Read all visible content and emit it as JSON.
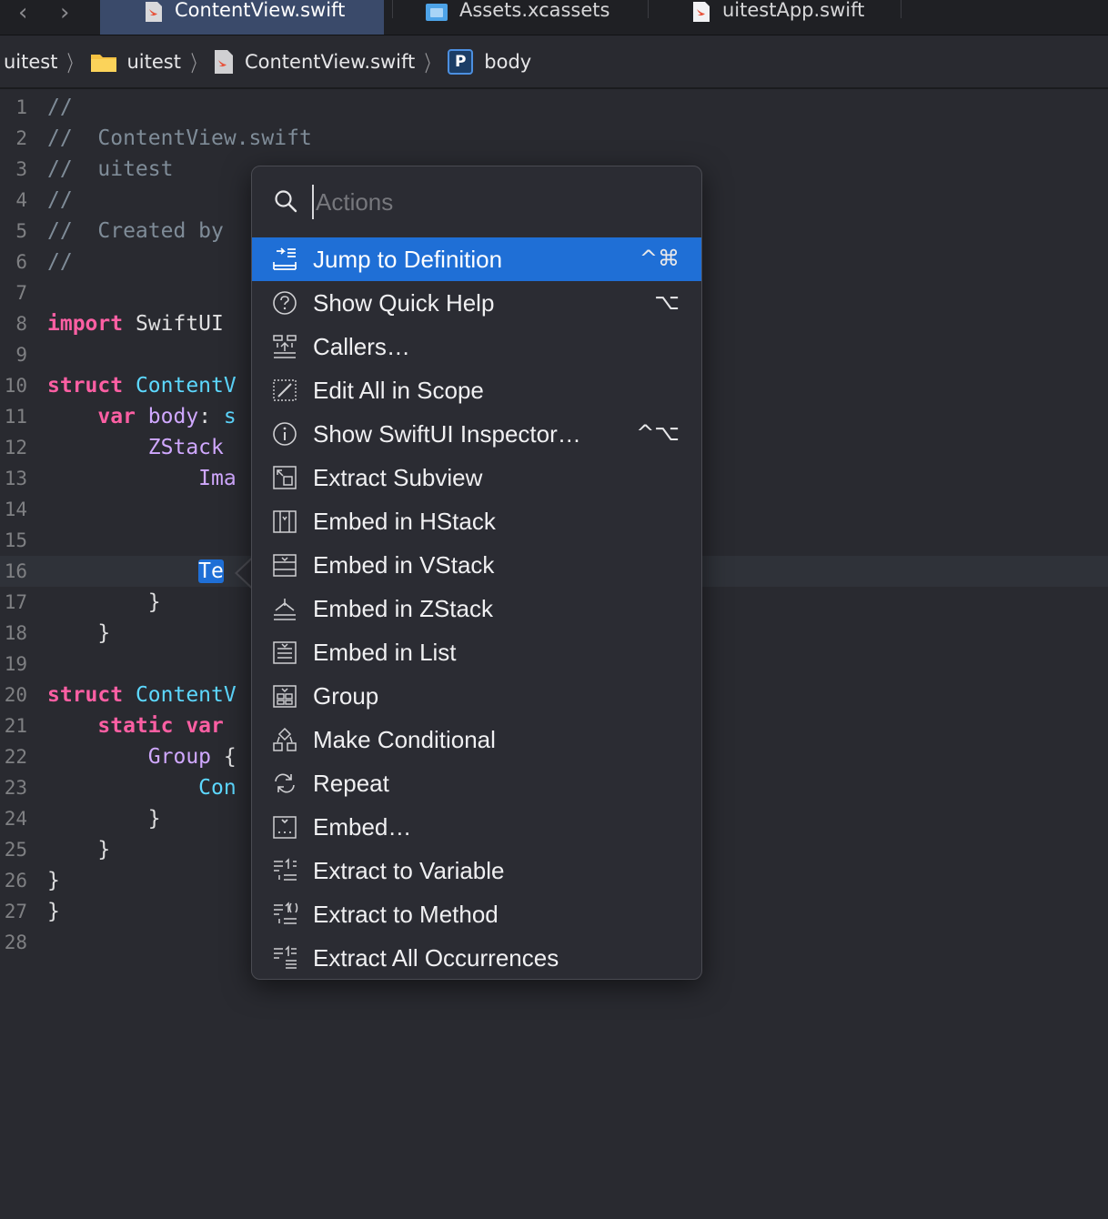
{
  "tabs": [
    {
      "label": "ContentView.swift",
      "icon": "swift-file-icon",
      "active": true
    },
    {
      "label": "Assets.xcassets",
      "icon": "asset-catalog-icon",
      "active": false
    },
    {
      "label": "uitestApp.swift",
      "icon": "swift-file-icon",
      "active": false
    }
  ],
  "jumpbar": {
    "project": "uitest",
    "group": "uitest",
    "file": "ContentView.swift",
    "symbol_badge": "P",
    "symbol": "body"
  },
  "editor": {
    "current_line": 16,
    "lines": [
      {
        "n": "1",
        "code": "//"
      },
      {
        "n": "2",
        "code": "//  ContentView.swift"
      },
      {
        "n": "3",
        "code": "//  uitest"
      },
      {
        "n": "4",
        "code": "//"
      },
      {
        "n": "5",
        "code": "//  Created by"
      },
      {
        "n": "6",
        "code": "//"
      },
      {
        "n": "7",
        "code": ""
      },
      {
        "n": "8",
        "kw": "import",
        "rest": " SwiftUI"
      },
      {
        "n": "9",
        "code": ""
      },
      {
        "n": "10",
        "kw": "struct",
        "type": " ContentV"
      },
      {
        "n": "11",
        "indent": "    ",
        "kw": "var",
        "prop": " body",
        "rest": ": ",
        "type": "s"
      },
      {
        "n": "12",
        "indent": "        ",
        "prop": "ZStack"
      },
      {
        "n": "13",
        "indent": "            ",
        "prop": "Ima"
      },
      {
        "n": "14",
        "code": ""
      },
      {
        "n": "15",
        "code": ""
      },
      {
        "n": "16",
        "indent": "            ",
        "sel": "Te"
      },
      {
        "n": "17",
        "code": "        }"
      },
      {
        "n": "18",
        "code": "    }"
      },
      {
        "n": "19",
        "code": ""
      },
      {
        "n": "20",
        "kw": "struct",
        "type": " ContentV"
      },
      {
        "n": "21",
        "indent": "    ",
        "kw": "static var"
      },
      {
        "n": "22",
        "indent": "        ",
        "prop": "Group",
        "rest": " {"
      },
      {
        "n": "23",
        "indent": "            ",
        "type": "Con"
      },
      {
        "n": "24",
        "code": "        }"
      },
      {
        "n": "25",
        "code": "    }"
      },
      {
        "n": "26",
        "code": "}"
      },
      {
        "n": "27",
        "code": "}"
      },
      {
        "n": "28",
        "code": ""
      }
    ]
  },
  "popover": {
    "search_placeholder": "Actions",
    "items": [
      {
        "label": "Jump to Definition",
        "shortcut": "^⌘",
        "icon": "jump-to-definition-icon",
        "selected": true
      },
      {
        "label": "Show Quick Help",
        "shortcut": "⌥",
        "icon": "question-circle-icon"
      },
      {
        "label": "Callers…",
        "shortcut": "",
        "icon": "callers-icon"
      },
      {
        "label": "Edit All in Scope",
        "shortcut": "",
        "icon": "edit-scope-icon"
      },
      {
        "label": "Show SwiftUI Inspector…",
        "shortcut": "^⌥",
        "icon": "info-circle-icon"
      },
      {
        "label": "Extract Subview",
        "shortcut": "",
        "icon": "extract-subview-icon"
      },
      {
        "label": "Embed in HStack",
        "shortcut": "",
        "icon": "hstack-icon"
      },
      {
        "label": "Embed in VStack",
        "shortcut": "",
        "icon": "vstack-icon"
      },
      {
        "label": "Embed in ZStack",
        "shortcut": "",
        "icon": "zstack-icon"
      },
      {
        "label": "Embed in List",
        "shortcut": "",
        "icon": "list-icon"
      },
      {
        "label": "Group",
        "shortcut": "",
        "icon": "group-icon"
      },
      {
        "label": "Make Conditional",
        "shortcut": "",
        "icon": "conditional-icon"
      },
      {
        "label": "Repeat",
        "shortcut": "",
        "icon": "repeat-icon"
      },
      {
        "label": "Embed…",
        "shortcut": "",
        "icon": "embed-icon"
      },
      {
        "label": "Extract to Variable",
        "shortcut": "",
        "icon": "extract-variable-icon"
      },
      {
        "label": "Extract to Method",
        "shortcut": "",
        "icon": "extract-method-icon"
      },
      {
        "label": "Extract All Occurrences",
        "shortcut": "",
        "icon": "extract-occurrences-icon"
      }
    ]
  },
  "colors": {
    "selection": "#1f6fd6",
    "keyword": "#fc5fa3",
    "type": "#5dd8ff",
    "property": "#d0a8ff",
    "comment": "#7f8c98"
  }
}
